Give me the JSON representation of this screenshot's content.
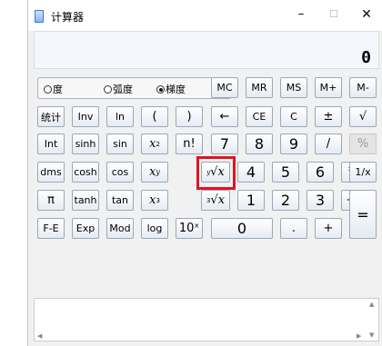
{
  "window": {
    "title": "计算器",
    "min_glyph": "–",
    "max_glyph": "☐",
    "close_glyph": "✕"
  },
  "display": {
    "value": "0"
  },
  "mode": {
    "options": [
      "度",
      "弧度",
      "梯度"
    ],
    "selected": "梯度"
  },
  "buttons": {
    "row1": [
      "MC",
      "MR",
      "MS",
      "M+",
      "M-"
    ],
    "row2": [
      "统计",
      "Inv",
      "ln",
      "(",
      ")",
      "←",
      "CE",
      "C",
      "±",
      "√"
    ],
    "row3": [
      "Int",
      "sinh",
      "sin",
      "x²",
      "n!",
      "7",
      "8",
      "9",
      "/",
      "%"
    ],
    "row4": [
      "dms",
      "cosh",
      "cos",
      "xʸ",
      "∜x",
      "4",
      "5",
      "6",
      "*",
      "1/x"
    ],
    "row5": [
      "π",
      "tanh",
      "tan",
      "x³",
      "∛x",
      "1",
      "2",
      "3",
      "−",
      "="
    ],
    "row6": [
      "F-E",
      "Exp",
      "Mod",
      "log",
      "10ˣ",
      "0",
      ".",
      "+"
    ]
  },
  "math": {
    "x": "x",
    "y": "y",
    "sup2": "2",
    "sup3": "3",
    "root_y": "y",
    "root_3": "3"
  },
  "scroll": {
    "up": "▲",
    "down": "▼",
    "left": "◀",
    "right": "▶"
  },
  "highlight_color": "#e0141e"
}
